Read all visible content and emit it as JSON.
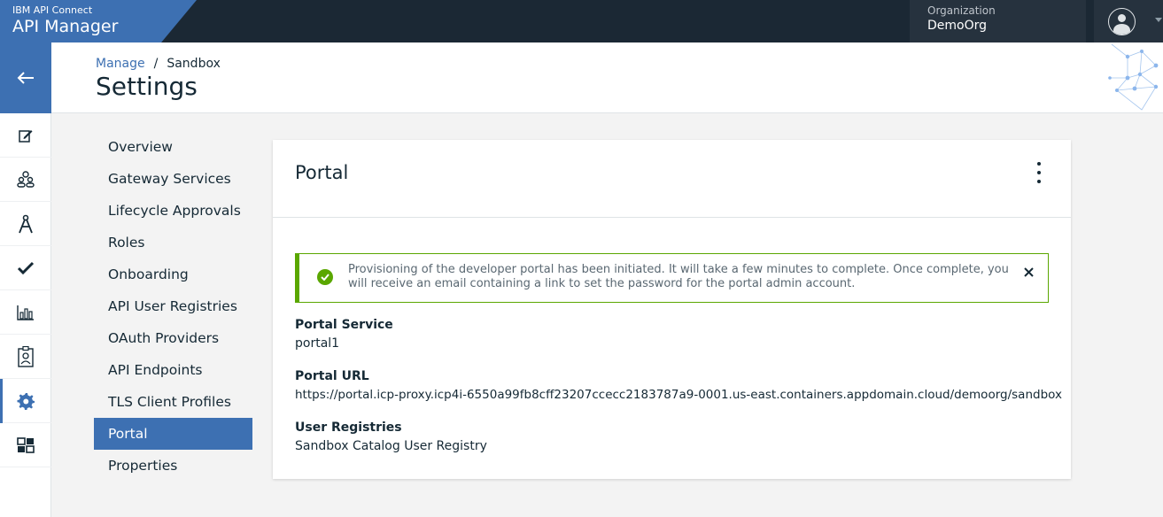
{
  "header": {
    "product": "IBM API Connect",
    "app_title": "API Manager",
    "org_label": "Organization",
    "org_value": "DemoOrg"
  },
  "leftnav": {
    "items": [
      "back-arrow-icon",
      "edit-icon",
      "community-icon",
      "compass-icon",
      "checkmark-icon",
      "analytics-icon",
      "member-badge-icon",
      "settings-gear-icon",
      "dashboard-grid-icon"
    ],
    "active": "settings-gear-icon"
  },
  "breadcrumb": {
    "manage": "Manage",
    "separator": "/",
    "current": "Sandbox"
  },
  "page_title": "Settings",
  "settings_menu": [
    "Overview",
    "Gateway Services",
    "Lifecycle Approvals",
    "Roles",
    "Onboarding",
    "API User Registries",
    "OAuth Providers",
    "API Endpoints",
    "TLS Client Profiles",
    "Portal",
    "Properties"
  ],
  "selected_menu": "Portal",
  "card": {
    "title": "Portal",
    "notification": "Provisioning of the developer portal has been initiated. It will take a few minutes to complete. Once complete, you will receive an email containing a link to set the password for the portal admin account.",
    "fields": [
      {
        "label": "Portal Service",
        "value": "portal1"
      },
      {
        "label": "Portal URL",
        "value": "https://portal.icp-proxy.icp4i-6550a99fb8cff23207ccecc2183787a9-0001.us-east.containers.appdomain.cloud/demoorg/sandbox"
      },
      {
        "label": "User Registries",
        "value": "Sandbox Catalog User Registry"
      }
    ]
  },
  "colors": {
    "brand_blue": "#3d70b2",
    "topbar": "#1b2834",
    "success_green": "#5aa700"
  }
}
